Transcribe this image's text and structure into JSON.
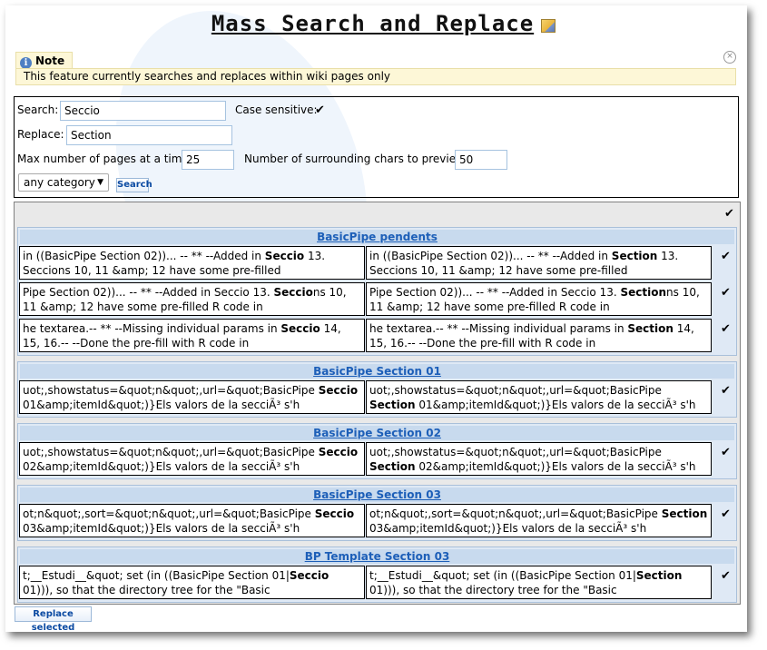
{
  "page": {
    "title": "Mass Search and Replace"
  },
  "note": {
    "heading": "Note",
    "text": "This feature currently searches and replaces within wiki pages only"
  },
  "form": {
    "search_label": "Search:",
    "search_value": "Seccio",
    "case_label": "Case sensitive:",
    "replace_label": "Replace:",
    "replace_value": "Section",
    "max_pages_label": "Max number of pages at a time:",
    "max_pages_value": "25",
    "surround_label": "Number of surrounding chars to preview:",
    "surround_value": "50",
    "category_value": "any category",
    "search_button": "Search"
  },
  "results": {
    "groups": [
      {
        "title": "BasicPipe pendents",
        "rows": [
          {
            "before": [
              "in ((BasicPipe Section 02))... -- ** --Added in ",
              "Seccio",
              " 13. Seccions 10, 11 &amp; 12 have some pre-filled"
            ],
            "after": [
              "in ((BasicPipe Section 02))... -- ** --Added in ",
              "Section",
              " 13. Seccions 10, 11 &amp; 12 have some pre-filled"
            ]
          },
          {
            "before": [
              "Pipe Section 02))... -- ** --Added in Seccio 13. ",
              "Seccio",
              "ns 10, 11 &amp; 12 have some pre-filled R code in"
            ],
            "after": [
              "Pipe Section 02))... -- ** --Added in Seccio 13. ",
              "Section",
              "ns 10, 11 &amp; 12 have some pre-filled R code in"
            ]
          },
          {
            "before": [
              "he textarea.-- ** --Missing individual params in ",
              "Seccio",
              " 14, 15, 16.-- --Done the pre-fill with R code in"
            ],
            "after": [
              "he textarea.-- ** --Missing individual params in ",
              "Section",
              " 14, 15, 16.-- --Done the pre-fill with R code in"
            ]
          }
        ]
      },
      {
        "title": "BasicPipe Section 01",
        "rows": [
          {
            "before": [
              "uot;,showstatus=&quot;n&quot;,url=&quot;BasicPipe ",
              "Seccio",
              " 01&amp;itemId&quot;)}Els valors de la secciÃ³ s'h"
            ],
            "after": [
              "uot;,showstatus=&quot;n&quot;,url=&quot;BasicPipe ",
              "Section",
              " 01&amp;itemId&quot;)}Els valors de la secciÃ³ s'h"
            ]
          }
        ]
      },
      {
        "title": "BasicPipe Section 02",
        "rows": [
          {
            "before": [
              "uot;,showstatus=&quot;n&quot;,url=&quot;BasicPipe ",
              "Seccio",
              " 02&amp;itemId&quot;)}Els valors de la secciÃ³ s'h"
            ],
            "after": [
              "uot;,showstatus=&quot;n&quot;,url=&quot;BasicPipe ",
              "Section",
              " 02&amp;itemId&quot;)}Els valors de la secciÃ³ s'h"
            ]
          }
        ]
      },
      {
        "title": "BasicPipe Section 03",
        "rows": [
          {
            "before": [
              "ot;n&quot;,sort=&quot;n&quot;,url=&quot;BasicPipe ",
              "Seccio",
              " 03&amp;itemId&quot;)}Els valors de la secciÃ³ s'h"
            ],
            "after": [
              "ot;n&quot;,sort=&quot;n&quot;,url=&quot;BasicPipe ",
              "Section",
              " 03&amp;itemId&quot;)}Els valors de la secciÃ³ s'h"
            ]
          }
        ]
      },
      {
        "title": "BP Template Section 03",
        "rows": [
          {
            "before": [
              "t;__Estudi__&quot; set (in ((BasicPipe Section 01|",
              "Seccio",
              " 01))), so that the directory tree for the \"Basic"
            ],
            "after": [
              "t;__Estudi__&quot; set (in ((BasicPipe Section 01|",
              "Section",
              " 01))), so that the directory tree for the \"Basic"
            ]
          }
        ]
      }
    ],
    "replace_button": "Replace selected"
  }
}
